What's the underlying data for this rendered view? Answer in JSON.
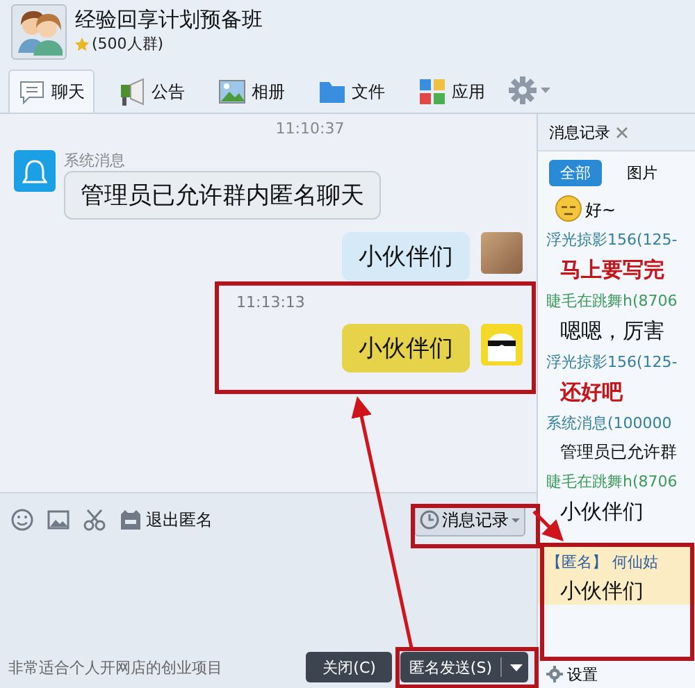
{
  "group": {
    "name": "经验回享计划预备班",
    "member_count": "(500人群)"
  },
  "tabs": [
    {
      "label": "聊天",
      "selected": true
    },
    {
      "label": "公告",
      "selected": false
    },
    {
      "label": "相册",
      "selected": false
    },
    {
      "label": "文件",
      "selected": false
    },
    {
      "label": "应用",
      "selected": false
    }
  ],
  "messages": [
    {
      "kind": "time",
      "text": "11:10:37"
    },
    {
      "kind": "system",
      "sender": "系统消息",
      "text": "管理员已允许群内匿名聊天"
    },
    {
      "kind": "outgoing",
      "text": "小伙伴们",
      "color": "#d5e9f6"
    },
    {
      "kind": "time",
      "text": "11:13:13"
    },
    {
      "kind": "outgoing-anonymous",
      "text": "小伙伴们",
      "color": "#e6d34a"
    }
  ],
  "input_toolbar": {
    "exit_anonymous": "退出匿名",
    "history_button": "消息记录"
  },
  "ad_text": "非常适合个人开网店的创业项目",
  "buttons": {
    "close": "关闭(C)",
    "send": "匿名发送(S)"
  },
  "history": {
    "title": "消息记录",
    "filters": [
      {
        "label": "全部",
        "selected": true
      },
      {
        "label": "图片",
        "selected": false
      }
    ],
    "entries": [
      {
        "kind": "emoji",
        "text": "好~"
      },
      {
        "kind": "sender",
        "text": "浮光掠影156(125-",
        "color": "#2f7f9e"
      },
      {
        "kind": "message",
        "text": "马上要写完",
        "color": "#c3151c"
      },
      {
        "kind": "sender",
        "text": "睫毛在跳舞h(8706",
        "color": "#3c9a5c"
      },
      {
        "kind": "message",
        "text": "嗯嗯，厉害",
        "color": "#111111"
      },
      {
        "kind": "sender",
        "text": "浮光掠影156(125-",
        "color": "#2f7f9e"
      },
      {
        "kind": "message",
        "text": "还好吧",
        "color": "#c3151c"
      },
      {
        "kind": "sender",
        "text": "系统消息(100000",
        "color": "#2f7f9e"
      },
      {
        "kind": "message-small",
        "text": "管理员已允许群",
        "color": "#111111"
      },
      {
        "kind": "sender",
        "text": "睫毛在跳舞h(8706",
        "color": "#3c9a5c"
      },
      {
        "kind": "message",
        "text": "小伙伴们",
        "color": "#111111"
      },
      {
        "kind": "anon",
        "tag": "【匿名】",
        "text": "何仙姑"
      },
      {
        "kind": "message-anon",
        "text": "小伙伴们",
        "color": "#111111"
      }
    ],
    "settings": "设置"
  }
}
